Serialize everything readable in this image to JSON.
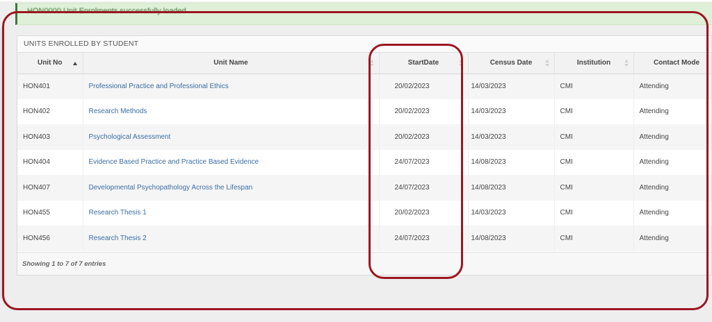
{
  "banner": {
    "message": "HON0000 Unit Enrolments successfully loaded"
  },
  "panel": {
    "title": "UNITS ENROLLED BY STUDENT"
  },
  "table": {
    "headers": {
      "unit_no": "Unit No",
      "unit_name": "Unit Name",
      "start_date": "StartDate",
      "census_date": "Census Date",
      "institution": "Institution",
      "contact_mode": "Contact Mode"
    },
    "rows": [
      {
        "unit_no": "HON401",
        "unit_name": "Professional Practice and Professional Ethics",
        "start_date": "20/02/2023",
        "census_date": "14/03/2023",
        "institution": "CMI",
        "contact_mode": "Attending"
      },
      {
        "unit_no": "HON402",
        "unit_name": "Research Methods",
        "start_date": "20/02/2023",
        "census_date": "14/03/2023",
        "institution": "CMI",
        "contact_mode": "Attending"
      },
      {
        "unit_no": "HON403",
        "unit_name": "Psychological Assessment",
        "start_date": "20/02/2023",
        "census_date": "14/03/2023",
        "institution": "CMI",
        "contact_mode": "Attending"
      },
      {
        "unit_no": "HON404",
        "unit_name": "Evidence Based Practice and Practice Based Evidence",
        "start_date": "24/07/2023",
        "census_date": "14/08/2023",
        "institution": "CMI",
        "contact_mode": "Attending"
      },
      {
        "unit_no": "HON407",
        "unit_name": "Developmental Psychopathology Across the Lifespan",
        "start_date": "24/07/2023",
        "census_date": "14/08/2023",
        "institution": "CMI",
        "contact_mode": "Attending"
      },
      {
        "unit_no": "HON455",
        "unit_name": "Research Thesis 1",
        "start_date": "20/02/2023",
        "census_date": "14/03/2023",
        "institution": "CMI",
        "contact_mode": "Attending"
      },
      {
        "unit_no": "HON456",
        "unit_name": "Research Thesis 2",
        "start_date": "24/07/2023",
        "census_date": "14/08/2023",
        "institution": "CMI",
        "contact_mode": "Attending"
      }
    ],
    "footer_info": "Showing 1 to 7 of 7 entries"
  },
  "colors": {
    "annotation": "#9b1520",
    "link": "#3a6ea5",
    "banner_bg": "#dff0d8"
  }
}
